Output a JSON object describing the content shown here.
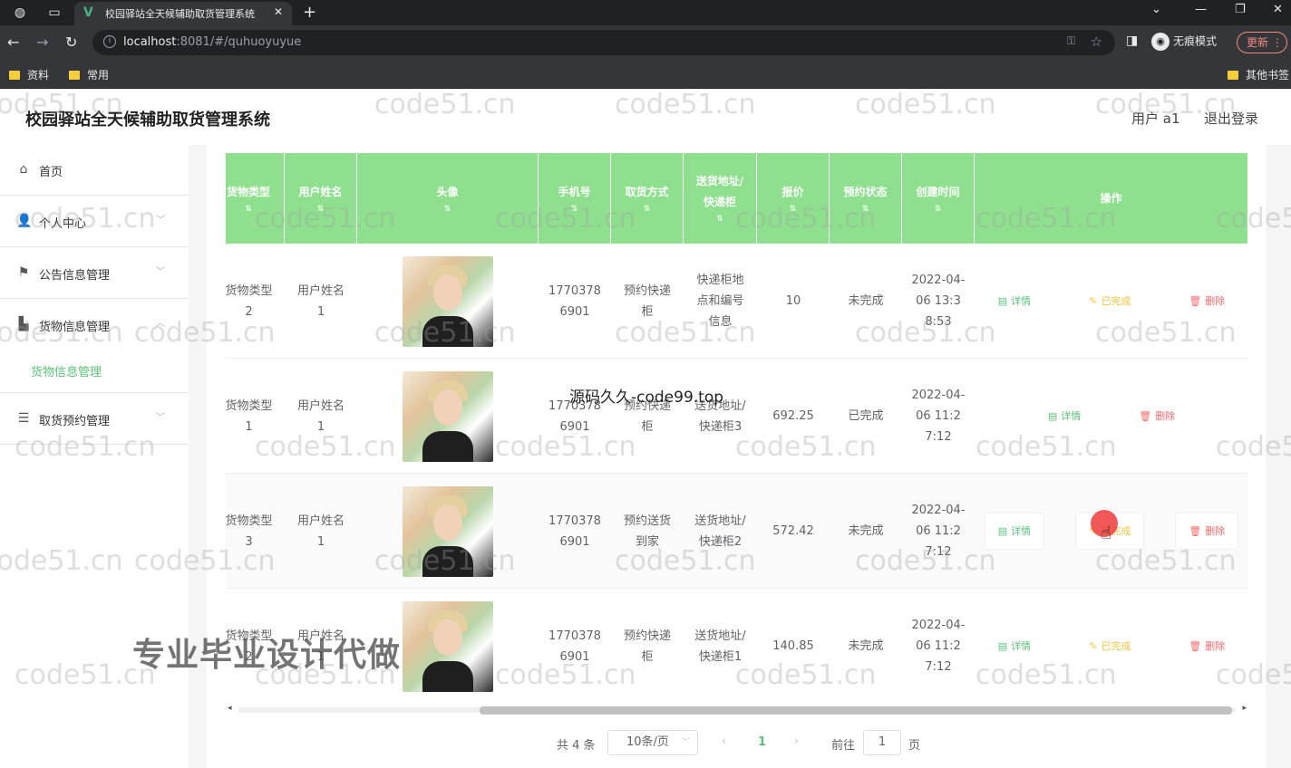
{
  "browser": {
    "tab_title": "校园驿站全天候辅助取货管理系统",
    "url_host": "localhost",
    "url_rest": ":8081/#/quhuoyuyue",
    "incognito_label": "无痕模式",
    "update_label": "更新",
    "bookmarks": [
      "资料",
      "常用"
    ],
    "other_bookmarks": "其他书签"
  },
  "header": {
    "title": "校园驿站全天候辅助取货管理系统",
    "user": "用户 a1",
    "logout": "退出登录"
  },
  "sidebar": {
    "items": [
      {
        "label": "首页",
        "icon": "home-icon"
      },
      {
        "label": "个人中心",
        "icon": "user-icon"
      },
      {
        "label": "公告信息管理",
        "icon": "flag-icon"
      },
      {
        "label": "货物信息管理",
        "icon": "goods-icon"
      },
      {
        "label": "取货预约管理",
        "icon": "list-icon"
      }
    ],
    "sub_active": "货物信息管理"
  },
  "table": {
    "columns": [
      "货物类型",
      "用户姓名",
      "头像",
      "手机号",
      "取货方式",
      "送货地址/快递柜",
      "报价",
      "预约状态",
      "创建时间",
      "操作"
    ],
    "rows": [
      {
        "type": "货物类型2",
        "name": "用户姓名1",
        "phone": "17703786901",
        "method": "预约快递柜",
        "address": "快递柜地点和编号信息",
        "price": "10",
        "status": "未完成",
        "created": "2022-04-06 13:38:53",
        "ops": [
          "详情",
          "已完成",
          "删除"
        ]
      },
      {
        "type": "货物类型1",
        "name": "用户姓名1",
        "phone": "17703786901",
        "method": "预约快递柜",
        "address": "送货地址/快递柜3",
        "price": "692.25",
        "status": "已完成",
        "created": "2022-04-06 11:27:12",
        "ops": [
          "详情",
          "删除"
        ]
      },
      {
        "type": "货物类型3",
        "name": "用户姓名1",
        "phone": "17703786901",
        "method": "预约送货到家",
        "address": "送货地址/快递柜2",
        "price": "572.42",
        "status": "未完成",
        "created": "2022-04-06 11:27:12",
        "ops": [
          "详情",
          "已完成",
          "删除"
        ]
      },
      {
        "type": "货物类型2",
        "name": "用户姓名1",
        "phone": "17703786901",
        "method": "预约快递柜",
        "address": "送货地址/快递柜1",
        "price": "140.85",
        "status": "未完成",
        "created": "2022-04-06 11:27:12",
        "ops": [
          "详情",
          "已完成",
          "删除"
        ]
      }
    ]
  },
  "pager": {
    "total": "共 4 条",
    "page_size": "10条/页",
    "current": "1",
    "goto_label": "前往",
    "goto_value": "1",
    "page_word": "页"
  },
  "overlays": {
    "watermark": "code51.cn",
    "center_text": "源码久久-code99.top",
    "promo_text": "专业毕业设计代做"
  }
}
